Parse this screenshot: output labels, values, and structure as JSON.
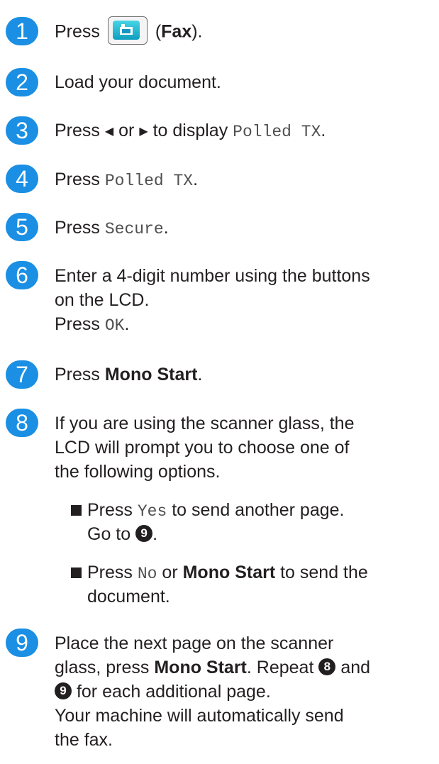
{
  "steps": [
    {
      "num": "1",
      "press": "Press",
      "fax_label": "Fax",
      "open": "(",
      "close": ")."
    },
    {
      "num": "2",
      "text": "Load your document."
    },
    {
      "num": "3",
      "pre": "Press",
      "left_arrow": "◀",
      "or": "or",
      "right_arrow": "▶",
      "mid": "to display",
      "mono": "Polled TX",
      "end": "."
    },
    {
      "num": "4",
      "pre": "Press",
      "mono": "Polled TX",
      "end": "."
    },
    {
      "num": "5",
      "pre": "Press",
      "mono": "Secure",
      "end": "."
    },
    {
      "num": "6",
      "line1": "Enter a 4-digit number using the buttons",
      "line2": "on the LCD.",
      "press": "Press",
      "mono": "OK",
      "end": "."
    },
    {
      "num": "7",
      "pre": "Press",
      "bold": "Mono Start",
      "end": "."
    },
    {
      "num": "8",
      "line1": "If you are using the scanner glass, the",
      "line2": "LCD will prompt you to choose one of",
      "line3": "the following options.",
      "bullets": [
        {
          "pre": "Press",
          "mono": "Yes",
          "mid": "to send another page.",
          "line2": "Go to",
          "ref": "9",
          "end": "."
        },
        {
          "pre": "Press",
          "mono": "No",
          "or": "or",
          "bold": "Mono Start",
          "mid": "to send the",
          "line2": "document."
        }
      ]
    },
    {
      "num": "9",
      "line1": "Place the next page on the scanner",
      "l2_pre": "glass, press",
      "l2_bold": "Mono Start",
      "l2_mid": ". Repeat",
      "ref_a": "8",
      "and": "and",
      "ref_b": "9",
      "l3": "for each additional page.",
      "line4": "Your machine will automatically send",
      "line5": "the fax."
    }
  ],
  "colors": {
    "badge": "#1a8fe3",
    "text": "#231f20"
  },
  "icons": {
    "fax_button": "fax-icon",
    "bullet": "square-bullet-icon"
  }
}
